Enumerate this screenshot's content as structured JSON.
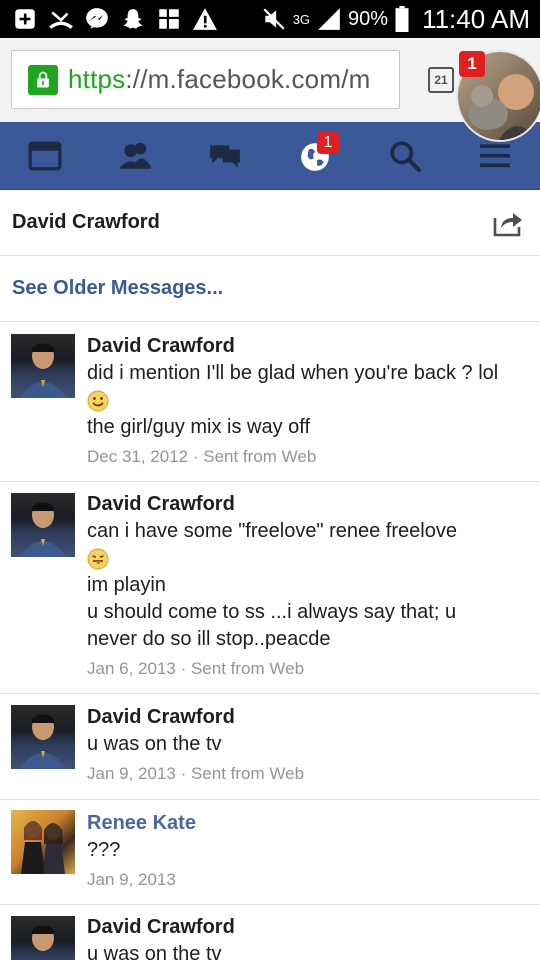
{
  "status_bar": {
    "network": "3G",
    "battery": "90%",
    "time": "11:40 AM"
  },
  "browser": {
    "url_scheme": "https",
    "url_rest": "://m.facebook.com/m",
    "tab_count": "21",
    "chathead_badge": "1"
  },
  "nav": {
    "notifications_badge": "1"
  },
  "conversation": {
    "title": "David Crawford",
    "see_older": "See Older Messages..."
  },
  "messages": [
    {
      "sender": "David Crawford",
      "lines": [
        "did i mention I'll be glad when you're back ? lol",
        "",
        "the girl/guy mix is way off"
      ],
      "emoji": "smile",
      "meta": "Dec 31, 2012 · Sent from Web"
    },
    {
      "sender": "David Crawford",
      "lines": [
        "can i have some \"freelove\" renee freelove",
        "",
        "im playin",
        "u should come to ss ...i always say that; u",
        "never do so ill stop..peacde"
      ],
      "emoji": "tongue",
      "meta": "Jan 6, 2013 · Sent from Web"
    },
    {
      "sender": "David Crawford",
      "lines": [
        "u was on the tv"
      ],
      "meta": "Jan 9, 2013 · Sent from Web"
    },
    {
      "sender": "Renee Kate",
      "lines": [
        "???"
      ],
      "meta": "Jan 9, 2013"
    },
    {
      "sender": "David Crawford",
      "lines": [
        "u was on the tv"
      ]
    }
  ],
  "colors": {
    "fb_blue": "#3b5998",
    "badge_red": "#e02020",
    "secure_green": "#1fa51f"
  }
}
